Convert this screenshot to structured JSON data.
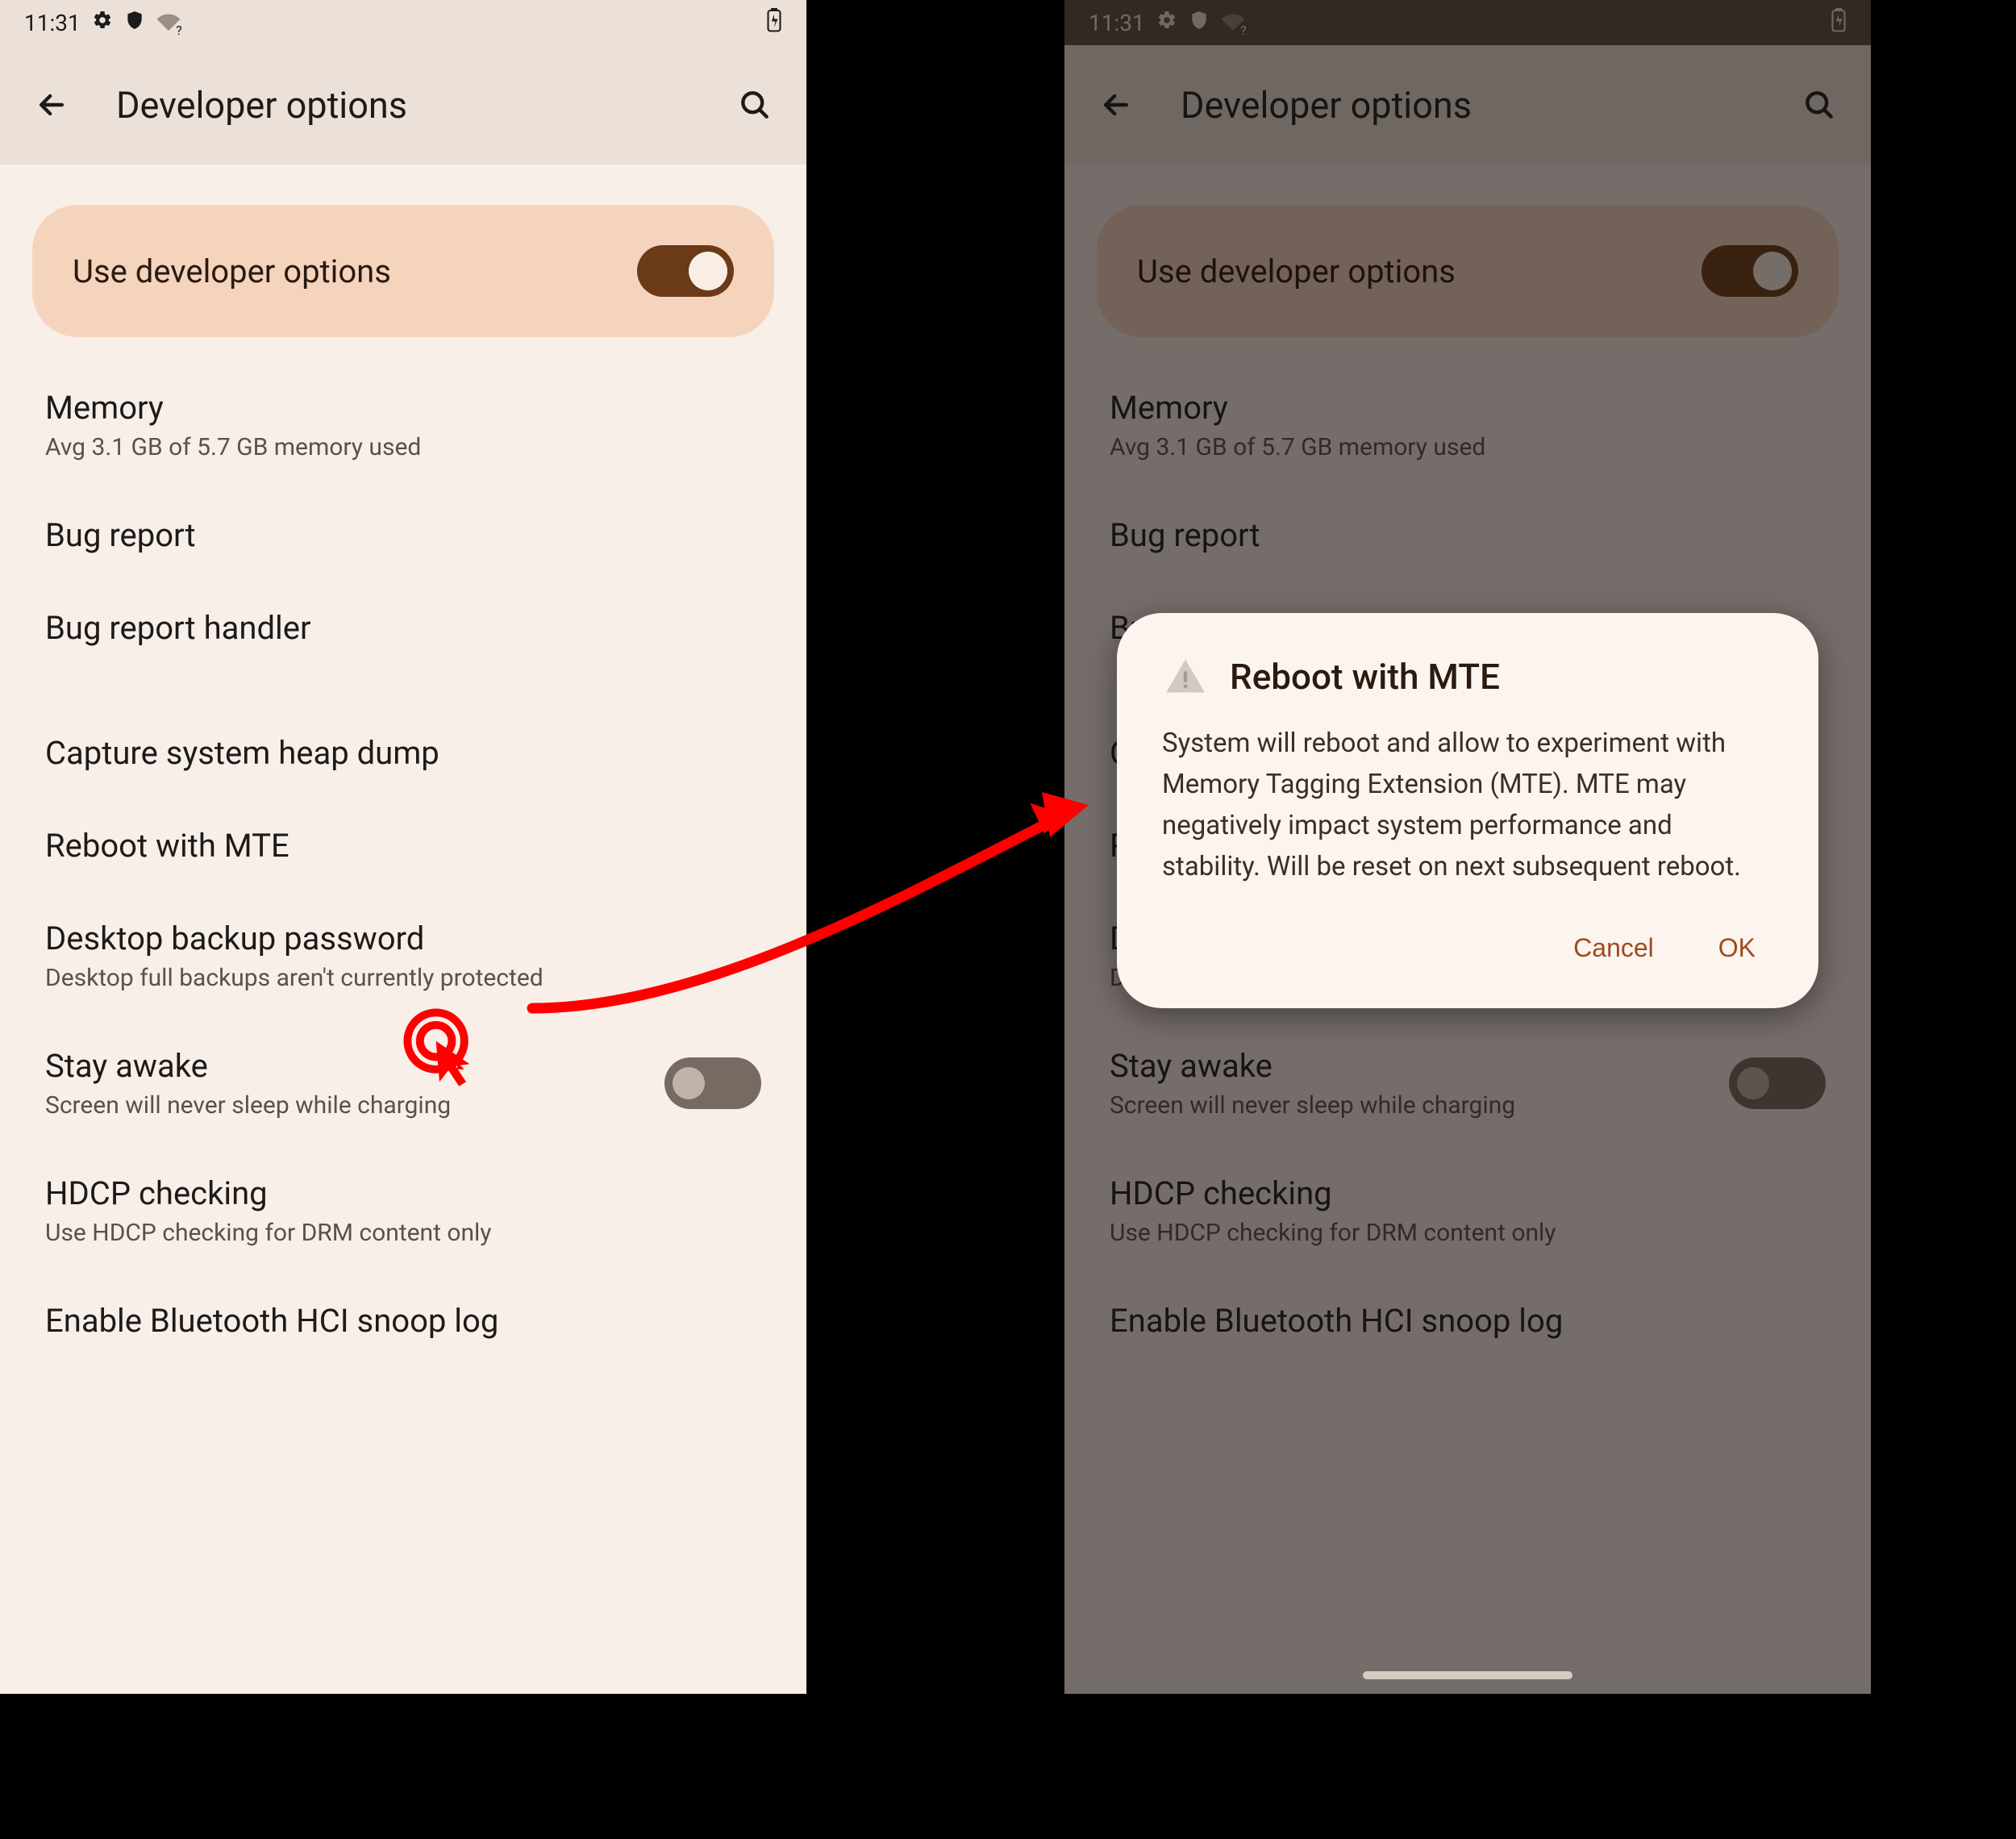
{
  "status": {
    "time": "11:31"
  },
  "app_bar": {
    "title": "Developer options"
  },
  "master_toggle": {
    "label": "Use developer options"
  },
  "items": {
    "memory": {
      "title": "Memory",
      "subtitle": "Avg 3.1 GB of 5.7 GB memory used"
    },
    "bug_report": {
      "title": "Bug report"
    },
    "bug_report_handler": {
      "title": "Bug report handler"
    },
    "capture_heap": {
      "title": "Capture system heap dump"
    },
    "reboot_mte": {
      "title": "Reboot with MTE"
    },
    "desktop_backup": {
      "title": "Desktop backup password",
      "subtitle": "Desktop full backups aren't currently protected"
    },
    "stay_awake": {
      "title": "Stay awake",
      "subtitle": "Screen will never sleep while charging"
    },
    "hdcp": {
      "title": "HDCP checking",
      "subtitle": "Use HDCP checking for DRM content only"
    },
    "bt_snoop": {
      "title": "Enable Bluetooth HCI snoop log"
    }
  },
  "dialog": {
    "title": "Reboot with MTE",
    "body": "System will reboot and allow to experiment with Memory Tagging Extension (MTE). MTE may negatively impact system performance and stability. Will be reset on next subsequent reboot.",
    "cancel": "Cancel",
    "ok": "OK"
  }
}
